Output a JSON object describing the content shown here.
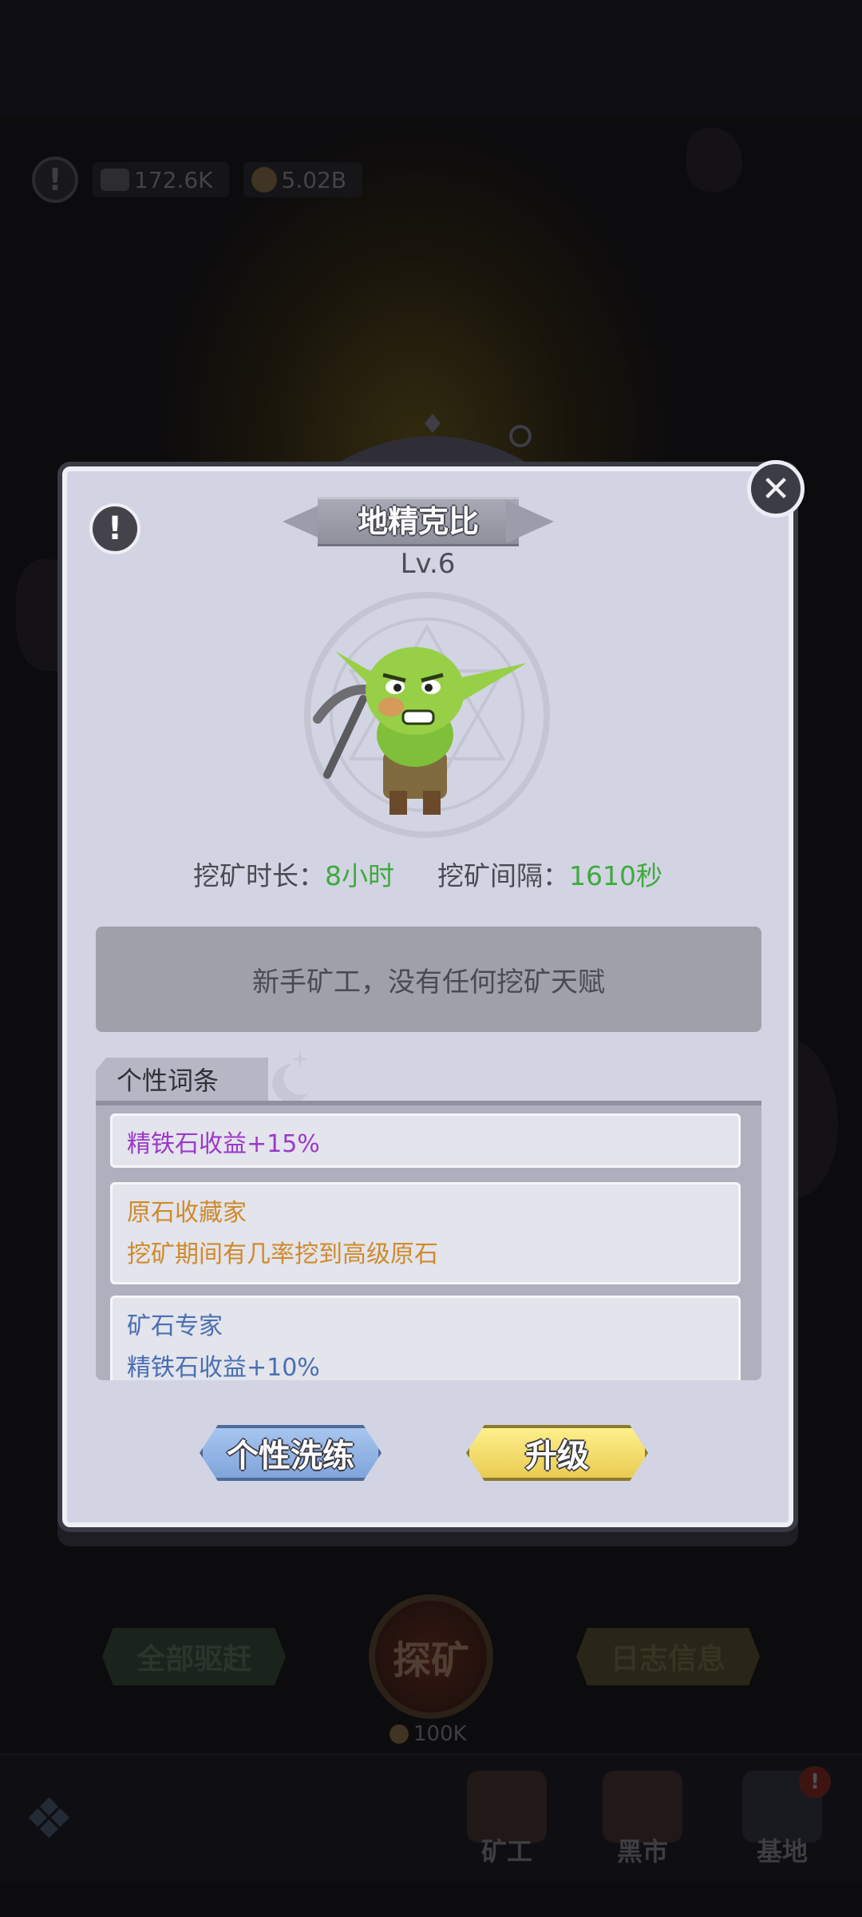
{
  "resources": {
    "ore_amount": "172.6K",
    "coin_amount": "5.02B"
  },
  "dialog": {
    "title": "地精克比",
    "level": "Lv.6",
    "stats": {
      "duration_label": "挖矿时长：",
      "duration_value": "8小时",
      "interval_label": "挖矿间隔：",
      "interval_value": "1610秒"
    },
    "description": "新手矿工，没有任何挖矿天赋",
    "traits_title": "个性词条",
    "traits": [
      {
        "name": "精铁石收益+15%",
        "detail": ""
      },
      {
        "name": "原石收藏家",
        "detail": "挖矿期间有几率挖到高级原石"
      },
      {
        "name": "矿石专家",
        "detail": "精铁石收益+10%"
      }
    ],
    "buttons": {
      "refine": "个性洗练",
      "upgrade": "升级"
    }
  },
  "bottom": {
    "dismiss_all": "全部驱赶",
    "explore": "探矿",
    "explore_cost": "100K",
    "log": "日志信息"
  },
  "nav": {
    "miner": "矿工",
    "market": "黑市",
    "base": "基地",
    "base_badge": "!"
  },
  "colors": {
    "trait_purple": "#9b39c9",
    "trait_orange": "#cf8a2c",
    "trait_blue": "#4a6fb1",
    "stat_green": "#3faa3e"
  }
}
